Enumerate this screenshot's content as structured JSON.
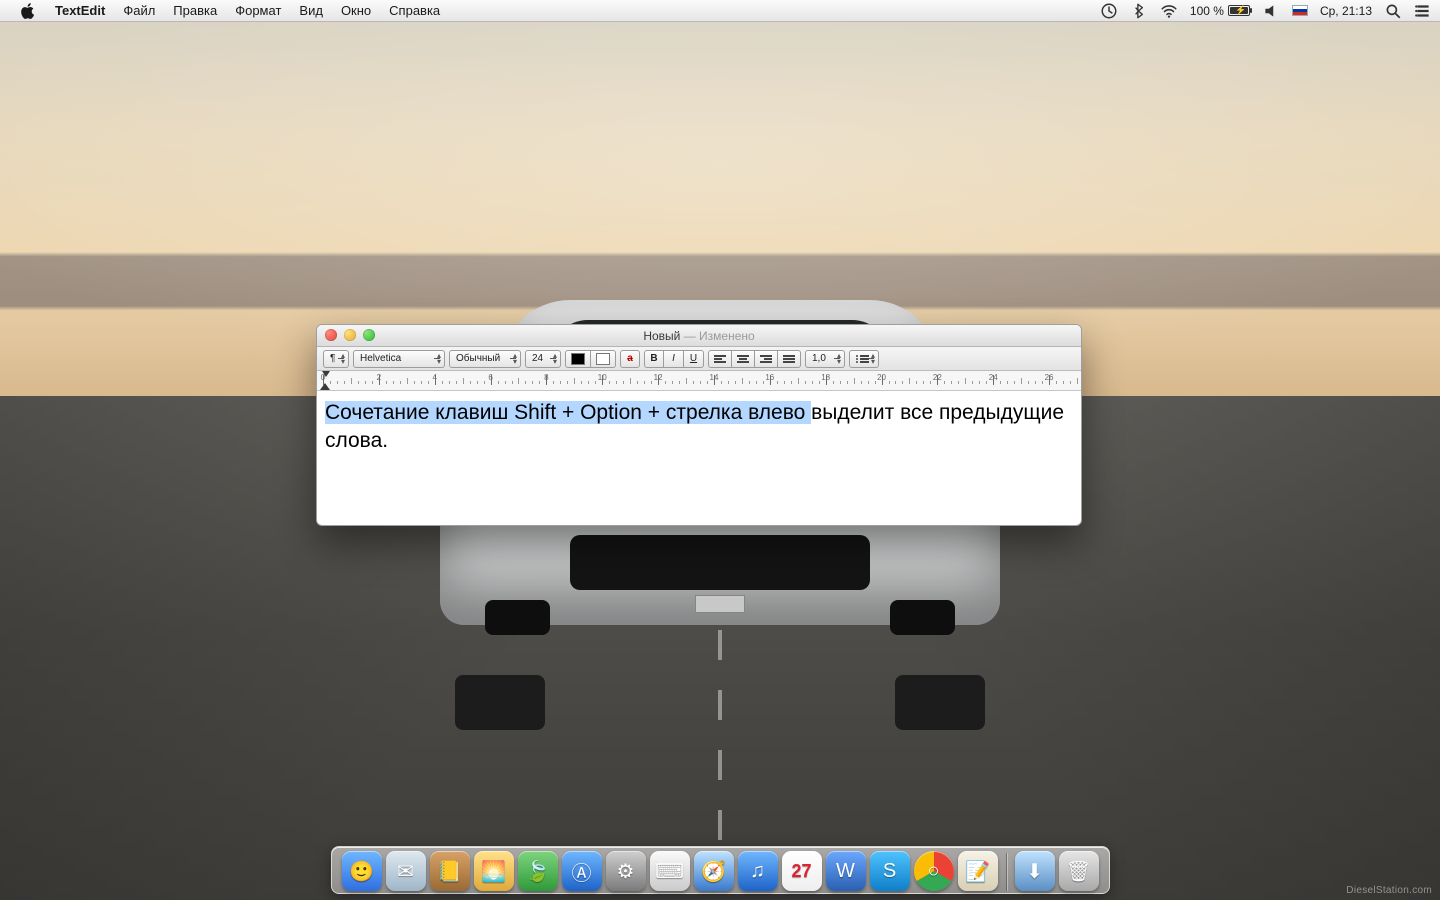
{
  "menubar": {
    "apple": "",
    "app_name": "TextEdit",
    "items": [
      "Файл",
      "Правка",
      "Формат",
      "Вид",
      "Окно",
      "Справка"
    ],
    "timemachine": "⟲",
    "bluetooth": "ᛒ",
    "wifi": "wifi",
    "battery_pct": "100 %",
    "battery_fill_pct": 100,
    "battery_charging": true,
    "volume": "vol",
    "input_flag": "ru",
    "clock": "Ср, 21:13",
    "spotlight": "⌕",
    "notifications": "≣"
  },
  "window": {
    "title_main": "Новый",
    "title_sub": " — Изменено",
    "toolbar": {
      "para_menu": "¶",
      "font_family": "Helvetica",
      "font_style": "Обычный",
      "font_size": "24",
      "color_fg": "#000000",
      "color_bg": "#ffffff",
      "strike_label": "a",
      "bold": "B",
      "italic": "I",
      "underline": "U",
      "line_spacing": "1,0"
    },
    "ruler": {
      "max": 27
    },
    "document": {
      "selected": "Сочетание клавиш Shift + Option + стрелка влево ",
      "rest": "выделит все предыдущие слова."
    }
  },
  "dock": {
    "apps": [
      {
        "name": "finder",
        "bg": "linear-gradient(#6fb7ff,#2f6fe0)",
        "glyph": "🙂"
      },
      {
        "name": "mail",
        "bg": "linear-gradient(#dfe8ef,#9fb6c8)",
        "glyph": "✉"
      },
      {
        "name": "contacts",
        "bg": "linear-gradient(#d7a268,#9a6a34)",
        "glyph": "📒"
      },
      {
        "name": "iphoto",
        "bg": "linear-gradient(#ffe28a,#e0a93a)",
        "glyph": "🌅"
      },
      {
        "name": "leaf",
        "bg": "linear-gradient(#7ed47e,#2f9a3a)",
        "glyph": "🍃"
      },
      {
        "name": "appstore",
        "bg": "linear-gradient(#6fb7ff,#1e63c8)",
        "glyph": "Ⓐ"
      },
      {
        "name": "preferences",
        "bg": "linear-gradient(#cfcfcf,#7a7a7a)",
        "glyph": "⚙"
      },
      {
        "name": "terminal",
        "bg": "linear-gradient(#fafafa,#cacaca)",
        "glyph": "⌨"
      },
      {
        "name": "safari",
        "bg": "linear-gradient(#bfe2ff,#3a7acb)",
        "glyph": "🧭"
      },
      {
        "name": "itunes",
        "bg": "linear-gradient(#6fb7ff,#1e63c8)",
        "glyph": "♫"
      },
      {
        "name": "calendar",
        "bg": "linear-gradient(#ffffff,#e8e8e8)",
        "glyph": "27"
      },
      {
        "name": "word",
        "bg": "linear-gradient(#6aa8ff,#2b5fb0)",
        "glyph": "W"
      },
      {
        "name": "skype",
        "bg": "linear-gradient(#4fc3ff,#0f7fc8)",
        "glyph": "S"
      },
      {
        "name": "chrome",
        "bg": "conic-gradient(#ea4335 0 120deg,#34a853 120deg 240deg,#fbbc05 240deg 360deg)",
        "glyph": "○"
      },
      {
        "name": "textedit",
        "bg": "linear-gradient(#f6f2e6,#d8cfb3)",
        "glyph": "📝"
      }
    ],
    "right": [
      {
        "name": "downloads",
        "bg": "linear-gradient(#bfe2ff,#5b8fc4)",
        "glyph": "⬇"
      },
      {
        "name": "trash",
        "bg": "linear-gradient(#e6e6e6,#a8a8a8)",
        "glyph": "🗑"
      }
    ]
  },
  "watermark": "DieselStation.com"
}
